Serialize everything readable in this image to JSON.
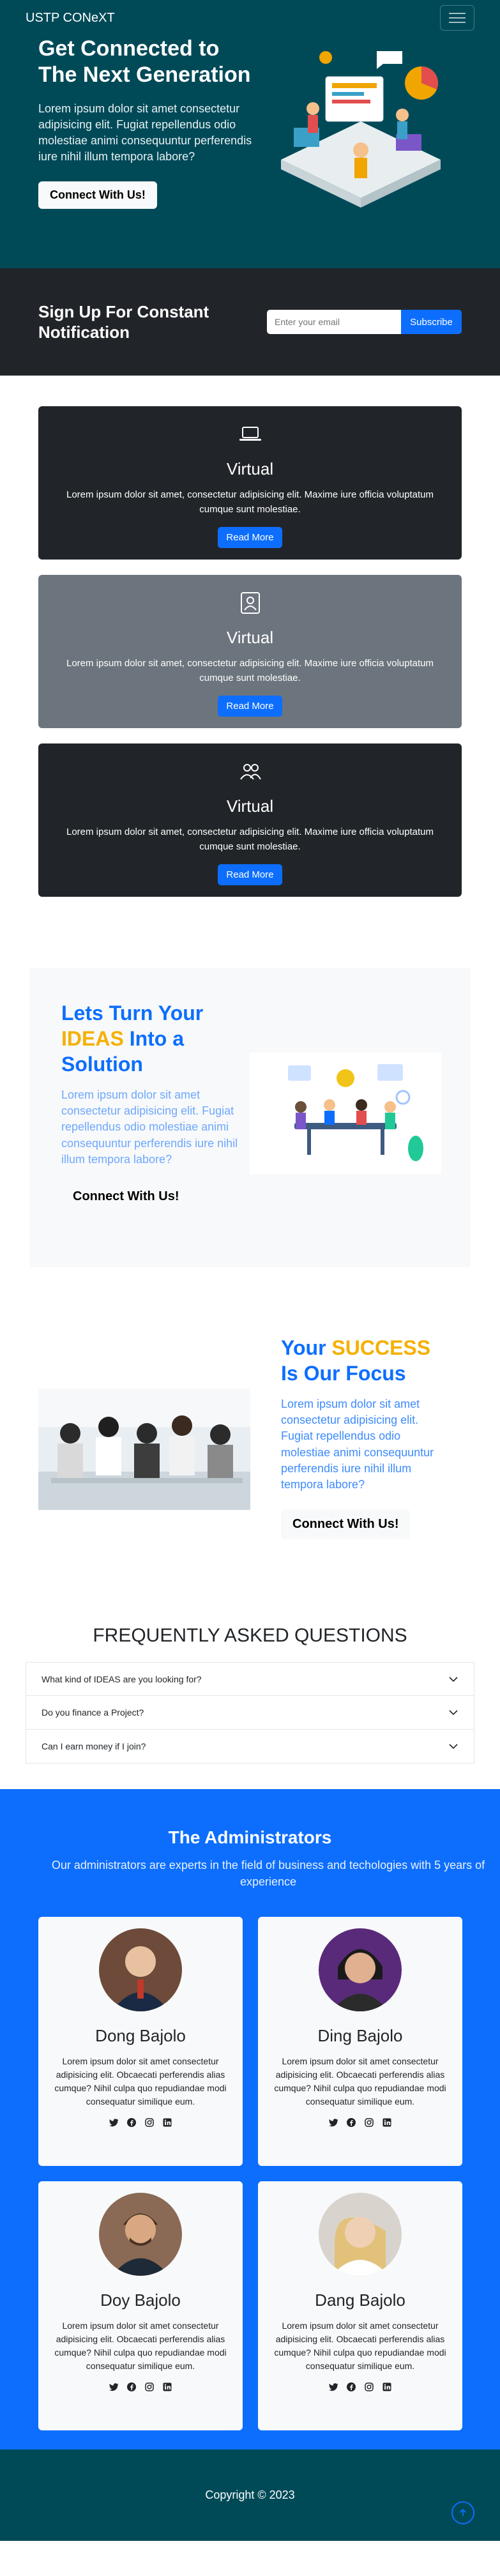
{
  "nav": {
    "brand": "USTP CONeXT",
    "menu_icon": "hamburger-icon"
  },
  "hero": {
    "title": "Get Connected to The Next Generation",
    "text": "Lorem ipsum dolor sit amet consectetur adipisicing elit. Fugiat repellendus odio molestiae animi consequuntur perferendis iure nihil illum tempora labore?",
    "button": "Connect With Us!"
  },
  "newsletter": {
    "title": "Sign Up For Constant Notification",
    "placeholder": "Enter your email",
    "button": "Subscribe"
  },
  "features": [
    {
      "icon": "laptop-icon",
      "title": "Virtual",
      "text": "Lorem ipsum dolor sit amet, consectetur adipisicing elit. Maxime iure officia voluptatum cumque sunt molestiae.",
      "button": "Read More"
    },
    {
      "icon": "person-badge-icon",
      "title": "Virtual",
      "text": "Lorem ipsum dolor sit amet, consectetur adipisicing elit. Maxime iure officia voluptatum cumque sunt molestiae.",
      "button": "Read More"
    },
    {
      "icon": "people-icon",
      "title": "Virtual",
      "text": "Lorem ipsum dolor sit amet, consectetur adipisicing elit. Maxime iure officia voluptatum cumque sunt molestiae.",
      "button": "Read More"
    }
  ],
  "ideas": {
    "title_pre": "Lets Turn Your",
    "title_accent": "IDEAS",
    "title_post": "Into a Solution",
    "text": "Lorem ipsum dolor sit amet consectetur adipisicing elit. Fugiat repellendus odio molestiae animi consequuntur perferendis iure nihil illum tempora labore?",
    "button": "Connect With Us!"
  },
  "success": {
    "title_pre": "Your",
    "title_accent": "SUCCESS",
    "title_post": "Is Our Focus",
    "text": "Lorem ipsum dolor sit amet consectetur adipisicing elit. Fugiat repellendus odio molestiae animi consequuntur perferendis iure nihil illum tempora labore?",
    "button": "Connect With Us!"
  },
  "faq": {
    "title": "FREQUENTLY ASKED QUESTIONS",
    "items": [
      "What kind of IDEAS are you looking for?",
      "Do you finance a Project?",
      "Can I earn money if I join?"
    ]
  },
  "admins": {
    "title": "The Administrators",
    "subtitle": "Our administrators are experts in the field of business and techologies with 5 years of experience",
    "people": [
      {
        "name": "Dong Bajolo",
        "text": "Lorem ipsum dolor sit amet consectetur adipisicing elit. Obcaecati perferendis alias cumque? Nihil culpa quo repudiandae modi consequatur similique eum."
      },
      {
        "name": "Ding Bajolo",
        "text": "Lorem ipsum dolor sit amet consectetur adipisicing elit. Obcaecati perferendis alias cumque? Nihil culpa quo repudiandae modi consequatur similique eum."
      },
      {
        "name": "Doy Bajolo",
        "text": "Lorem ipsum dolor sit amet consectetur adipisicing elit. Obcaecati perferendis alias cumque? Nihil culpa quo repudiandae modi consequatur similique eum."
      },
      {
        "name": "Dang Bajolo",
        "text": "Lorem ipsum dolor sit amet consectetur adipisicing elit. Obcaecati perferendis alias cumque? Nihil culpa quo repudiandae modi consequatur similique eum."
      }
    ],
    "social_icons": [
      "twitter-icon",
      "facebook-icon",
      "instagram-icon",
      "linkedin-icon"
    ]
  },
  "footer": {
    "copyright": "Copyright © 2023"
  },
  "colors": {
    "teal": "#004a58",
    "dark": "#212529",
    "gray": "#6c757d",
    "primary": "#0d6efd",
    "accent": "#f5b000"
  }
}
